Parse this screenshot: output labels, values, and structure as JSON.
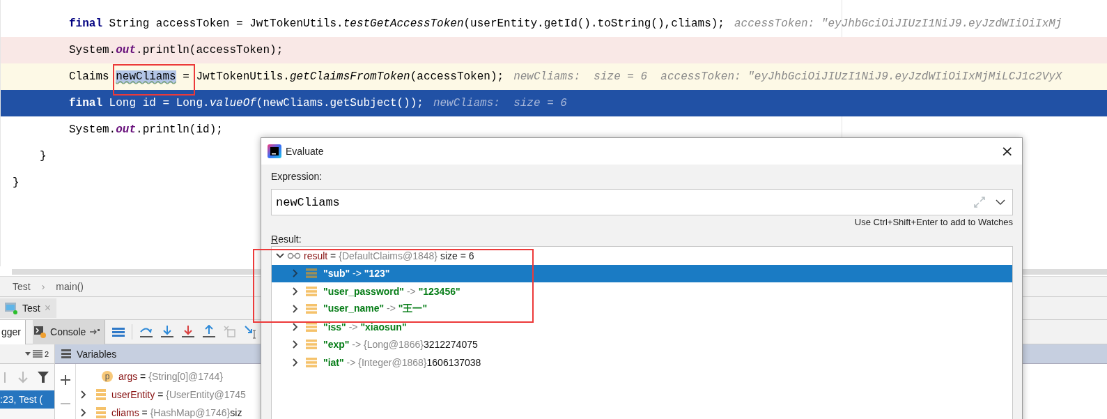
{
  "editor": {
    "closing": "}",
    "children": [
      {
        "closing": "}",
        "children": [
          {
            "breakpoint": false,
            "caret": false,
            "execution": false,
            "segments": [
              {
                "kind": "kw",
                "text": "final"
              },
              {
                "kind": "plain",
                "text": " String accessToken = JwtTokenUtils."
              },
              {
                "kind": "italic",
                "text": "testGetAccessToken"
              },
              {
                "kind": "plain",
                "text": "(userEntity.getId().toString(),cliams);"
              }
            ],
            "hint": "accessToken: \"eyJhbGciOiJIUzI1NiJ9.eyJzdWIiOiIxMj"
          },
          {
            "breakpoint": true,
            "caret": false,
            "execution": false,
            "segments": [
              {
                "kind": "plain",
                "text": "System."
              },
              {
                "kind": "static",
                "text": "out"
              },
              {
                "kind": "plain",
                "text": ".println(accessToken);"
              }
            ]
          },
          {
            "breakpoint": false,
            "caret": true,
            "execution": false,
            "segments": [
              {
                "kind": "plain",
                "text": "Claims "
              },
              {
                "kind": "selected",
                "text": "newCliams"
              },
              {
                "kind": "plain",
                "text": " = JwtTokenUtils."
              },
              {
                "kind": "italic",
                "text": "getClaimsFromToken"
              },
              {
                "kind": "plain",
                "text": "(accessToken);"
              }
            ],
            "hint": "newCliams:  size = 6  accessToken: \"eyJhbGciOiJIUzI1NiJ9.eyJzdWIiOiIxMjMiLCJ1c2VyX"
          },
          {
            "breakpoint": false,
            "caret": false,
            "execution": true,
            "segments": [
              {
                "kind": "kw",
                "text": "final"
              },
              {
                "kind": "plain",
                "text": " Long id = Long."
              },
              {
                "kind": "italic",
                "text": "valueOf"
              },
              {
                "kind": "plain",
                "text": "(newCliams.getSubject());"
              }
            ],
            "hint": "newCliams:  size = 6"
          },
          {
            "breakpoint": false,
            "caret": false,
            "execution": false,
            "segments": [
              {
                "kind": "plain",
                "text": "System."
              },
              {
                "kind": "static",
                "text": "out"
              },
              {
                "kind": "plain",
                "text": ".println(id);"
              }
            ]
          }
        ]
      }
    ]
  },
  "breadcrumbs": [
    "Test",
    "›",
    "main()"
  ],
  "run_tab": {
    "label": "Test",
    "close": "×"
  },
  "debug_tabs": [
    {
      "label": "gger",
      "selected": true
    },
    {
      "label": "Console",
      "selected": false
    }
  ],
  "frames": {
    "header_count": "2",
    "rows": [
      {
        "label": ":23, Test (",
        "selected": true
      }
    ]
  },
  "variables": {
    "title": "Variables",
    "rows": [
      {
        "kind": "parameter",
        "badge": "p",
        "name": "args",
        "equals": "=",
        "value": "{String[0]@1744}"
      },
      {
        "kind": "field",
        "name": "userEntity",
        "equals": "=",
        "value": "{UserEntity@1745"
      },
      {
        "kind": "field",
        "name": "cliams",
        "equals": "=",
        "value": "{HashMap@1746}",
        "extra": "siz"
      }
    ]
  },
  "dialog": {
    "title": "Evaluate",
    "close": "×",
    "expression_label": "Expression:",
    "expression": {
      "value": "newCliams"
    },
    "shortcut_hint": "Use Ctrl+Shift+Enter to add to Watches",
    "result_label": "Result:",
    "result": {
      "name": "result",
      "equals": "=",
      "type": "{DefaultClaims@1848}",
      "size": "size = 6",
      "expanded": true,
      "children": [
        {
          "key": "\"sub\"",
          "arrow": "->",
          "value": "\"123\"",
          "selected": true,
          "expanded": false
        },
        {
          "key": "\"user_password\"",
          "arrow": "->",
          "value": "\"123456\"",
          "selected": false,
          "expanded": false
        },
        {
          "key": "\"user_name\"",
          "arrow": "->",
          "value": "\"王一\"",
          "selected": false,
          "expanded": false
        },
        {
          "key": "\"iss\"",
          "arrow": "->",
          "value": "\"xiaosun\"",
          "selected": false,
          "expanded": false
        },
        {
          "key": "\"exp\"",
          "arrow": "->",
          "type": "{Long@1866}",
          "value": "3212274075",
          "selected": false,
          "expanded": false
        },
        {
          "key": "\"iat\"",
          "arrow": "->",
          "type": "{Integer@1868}",
          "value": "1606137038",
          "selected": false,
          "expanded": false
        }
      ]
    }
  }
}
